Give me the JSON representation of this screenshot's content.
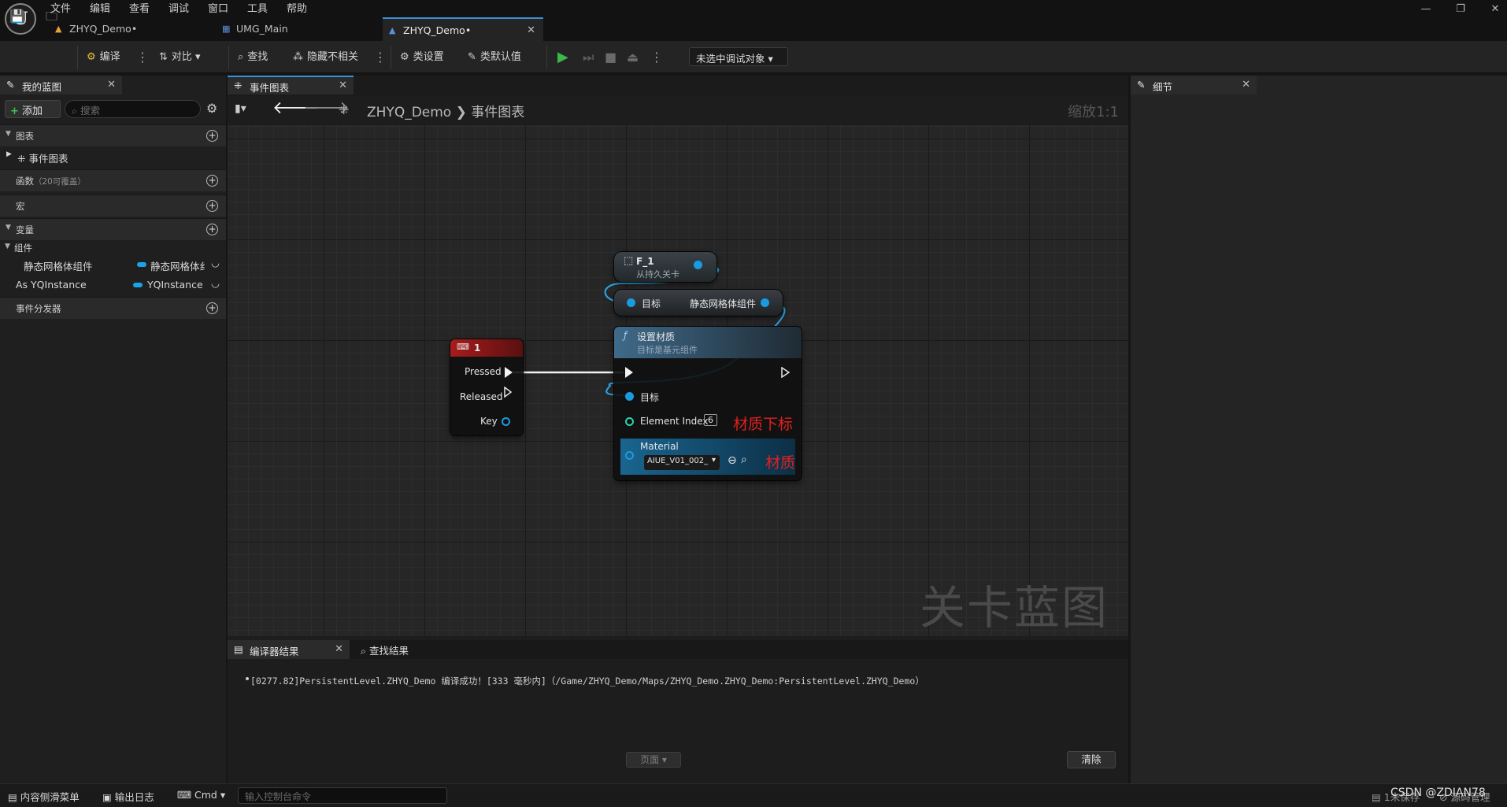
{
  "menu": [
    "文件",
    "编辑",
    "查看",
    "调试",
    "窗口",
    "工具",
    "帮助"
  ],
  "doc_tabs": [
    "ZHYQ_Demo•",
    "UMG_Main",
    "ZHYQ_Demo•"
  ],
  "toolbar": {
    "compile": "编译",
    "diff": "对比",
    "find": "查找",
    "hide_unrelated": "隐藏不相关",
    "class_settings": "类设置",
    "class_defaults": "类默认值",
    "debug_object": "未选中调试对象"
  },
  "my_blueprint": {
    "tab": "我的蓝图",
    "add": "添加",
    "search_placeholder": "搜索",
    "graphs": "图表",
    "event_graph": "事件图表",
    "functions": "函数",
    "functions_count": "（20可覆盖）",
    "macros": "宏",
    "variables": "变量",
    "components": "组件",
    "vars": [
      {
        "name": "静态网格体组件",
        "type": "静态网格体纟"
      },
      {
        "name": "As YQInstance",
        "type": "YQInstance"
      }
    ],
    "event_dispatchers": "事件分发器"
  },
  "graph": {
    "tab": "事件图表",
    "crumb_root": "ZHYQ_Demo",
    "crumb_leaf": "事件图表",
    "zoom": "缩放1:1",
    "watermark": "关卡蓝图",
    "nodes": {
      "f1": {
        "title": "F_1",
        "subtitle": "从持久关卡"
      },
      "get": {
        "target": "目标",
        "output": "静态网格体组件"
      },
      "key": {
        "title": "1",
        "pressed": "Pressed",
        "released": "Released",
        "key": "Key"
      },
      "setmat": {
        "title": "设置材质",
        "subtitle": "目标是基元组件",
        "target": "目标",
        "element_index": "Element Index",
        "element_index_value": "6",
        "material": "Material",
        "material_value": "AIUE_V01_002_"
      }
    },
    "annotations": {
      "index": "材质下标",
      "material": "材质"
    }
  },
  "compiler": {
    "tab": "编译器结果",
    "find_tab": "查找结果",
    "log": "[0277.82]PersistentLevel.ZHYQ_Demo 编译成功！[333 毫秒内]（/Game/ZHYQ_Demo/Maps/ZHYQ_Demo.ZHYQ_Demo:PersistentLevel.ZHYQ_Demo）",
    "page": "页面",
    "clear": "清除"
  },
  "details": {
    "tab": "细节"
  },
  "statusbar": {
    "content_drawer": "内容侧滑菜单",
    "output_log": "输出日志",
    "cmd": "Cmd",
    "console_placeholder": "输入控制台命令",
    "unsaved": "1未保存",
    "source_control": "源码管理",
    "csdn": "CSDN @ZDIAN78"
  }
}
